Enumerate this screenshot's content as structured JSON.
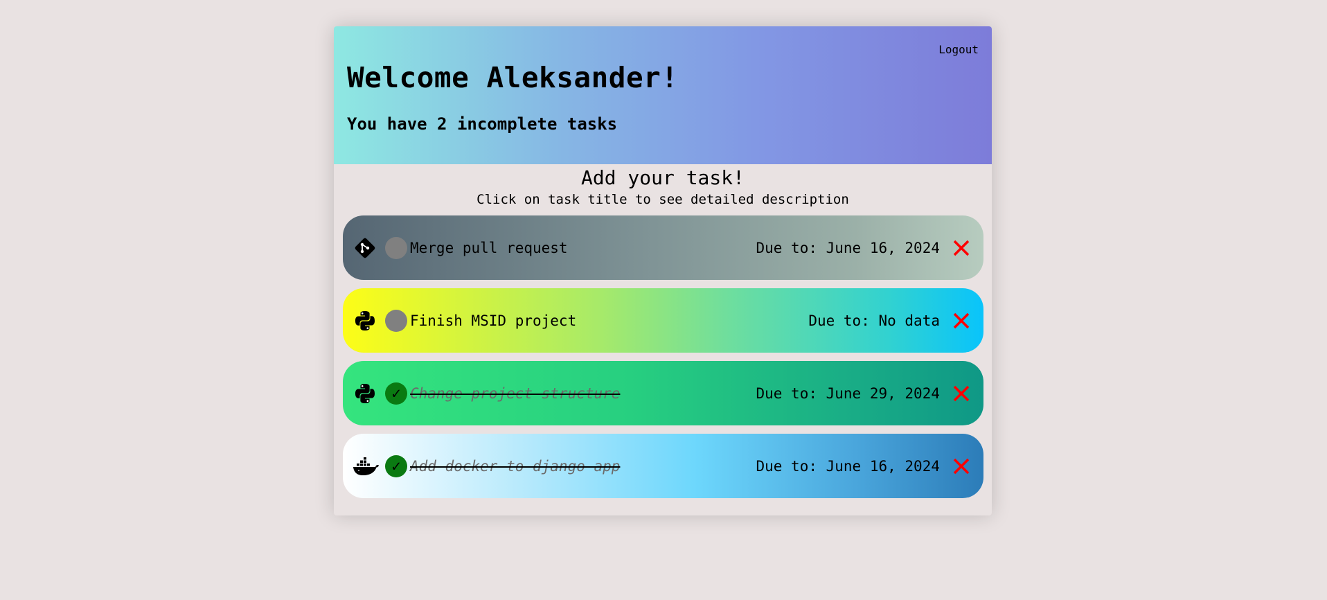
{
  "header": {
    "logout": "Logout",
    "welcome": "Welcome Aleksander!",
    "incomplete": "You have 2 incomplete tasks"
  },
  "main": {
    "add_title": "Add your task!",
    "hint": "Click on task title to see detailed description"
  },
  "tasks": [
    {
      "icon": "git-icon",
      "status": "incomplete",
      "check": "",
      "title": "Merge pull request",
      "due": "Due to: June 16, 2024"
    },
    {
      "icon": "python-icon",
      "status": "incomplete",
      "check": "",
      "title": "Finish MSID project",
      "due": "Due to: No data"
    },
    {
      "icon": "python-icon",
      "status": "complete",
      "check": "✓",
      "title": "Change project structure",
      "due": "Due to: June 29, 2024"
    },
    {
      "icon": "docker-icon",
      "status": "complete",
      "check": "✓",
      "title": "Add docker to django app",
      "due": "Due to: June 16, 2024"
    }
  ],
  "colors": {
    "delete": "#ff0000",
    "incomplete_status": "#808080",
    "complete_status": "#0a7a12"
  }
}
